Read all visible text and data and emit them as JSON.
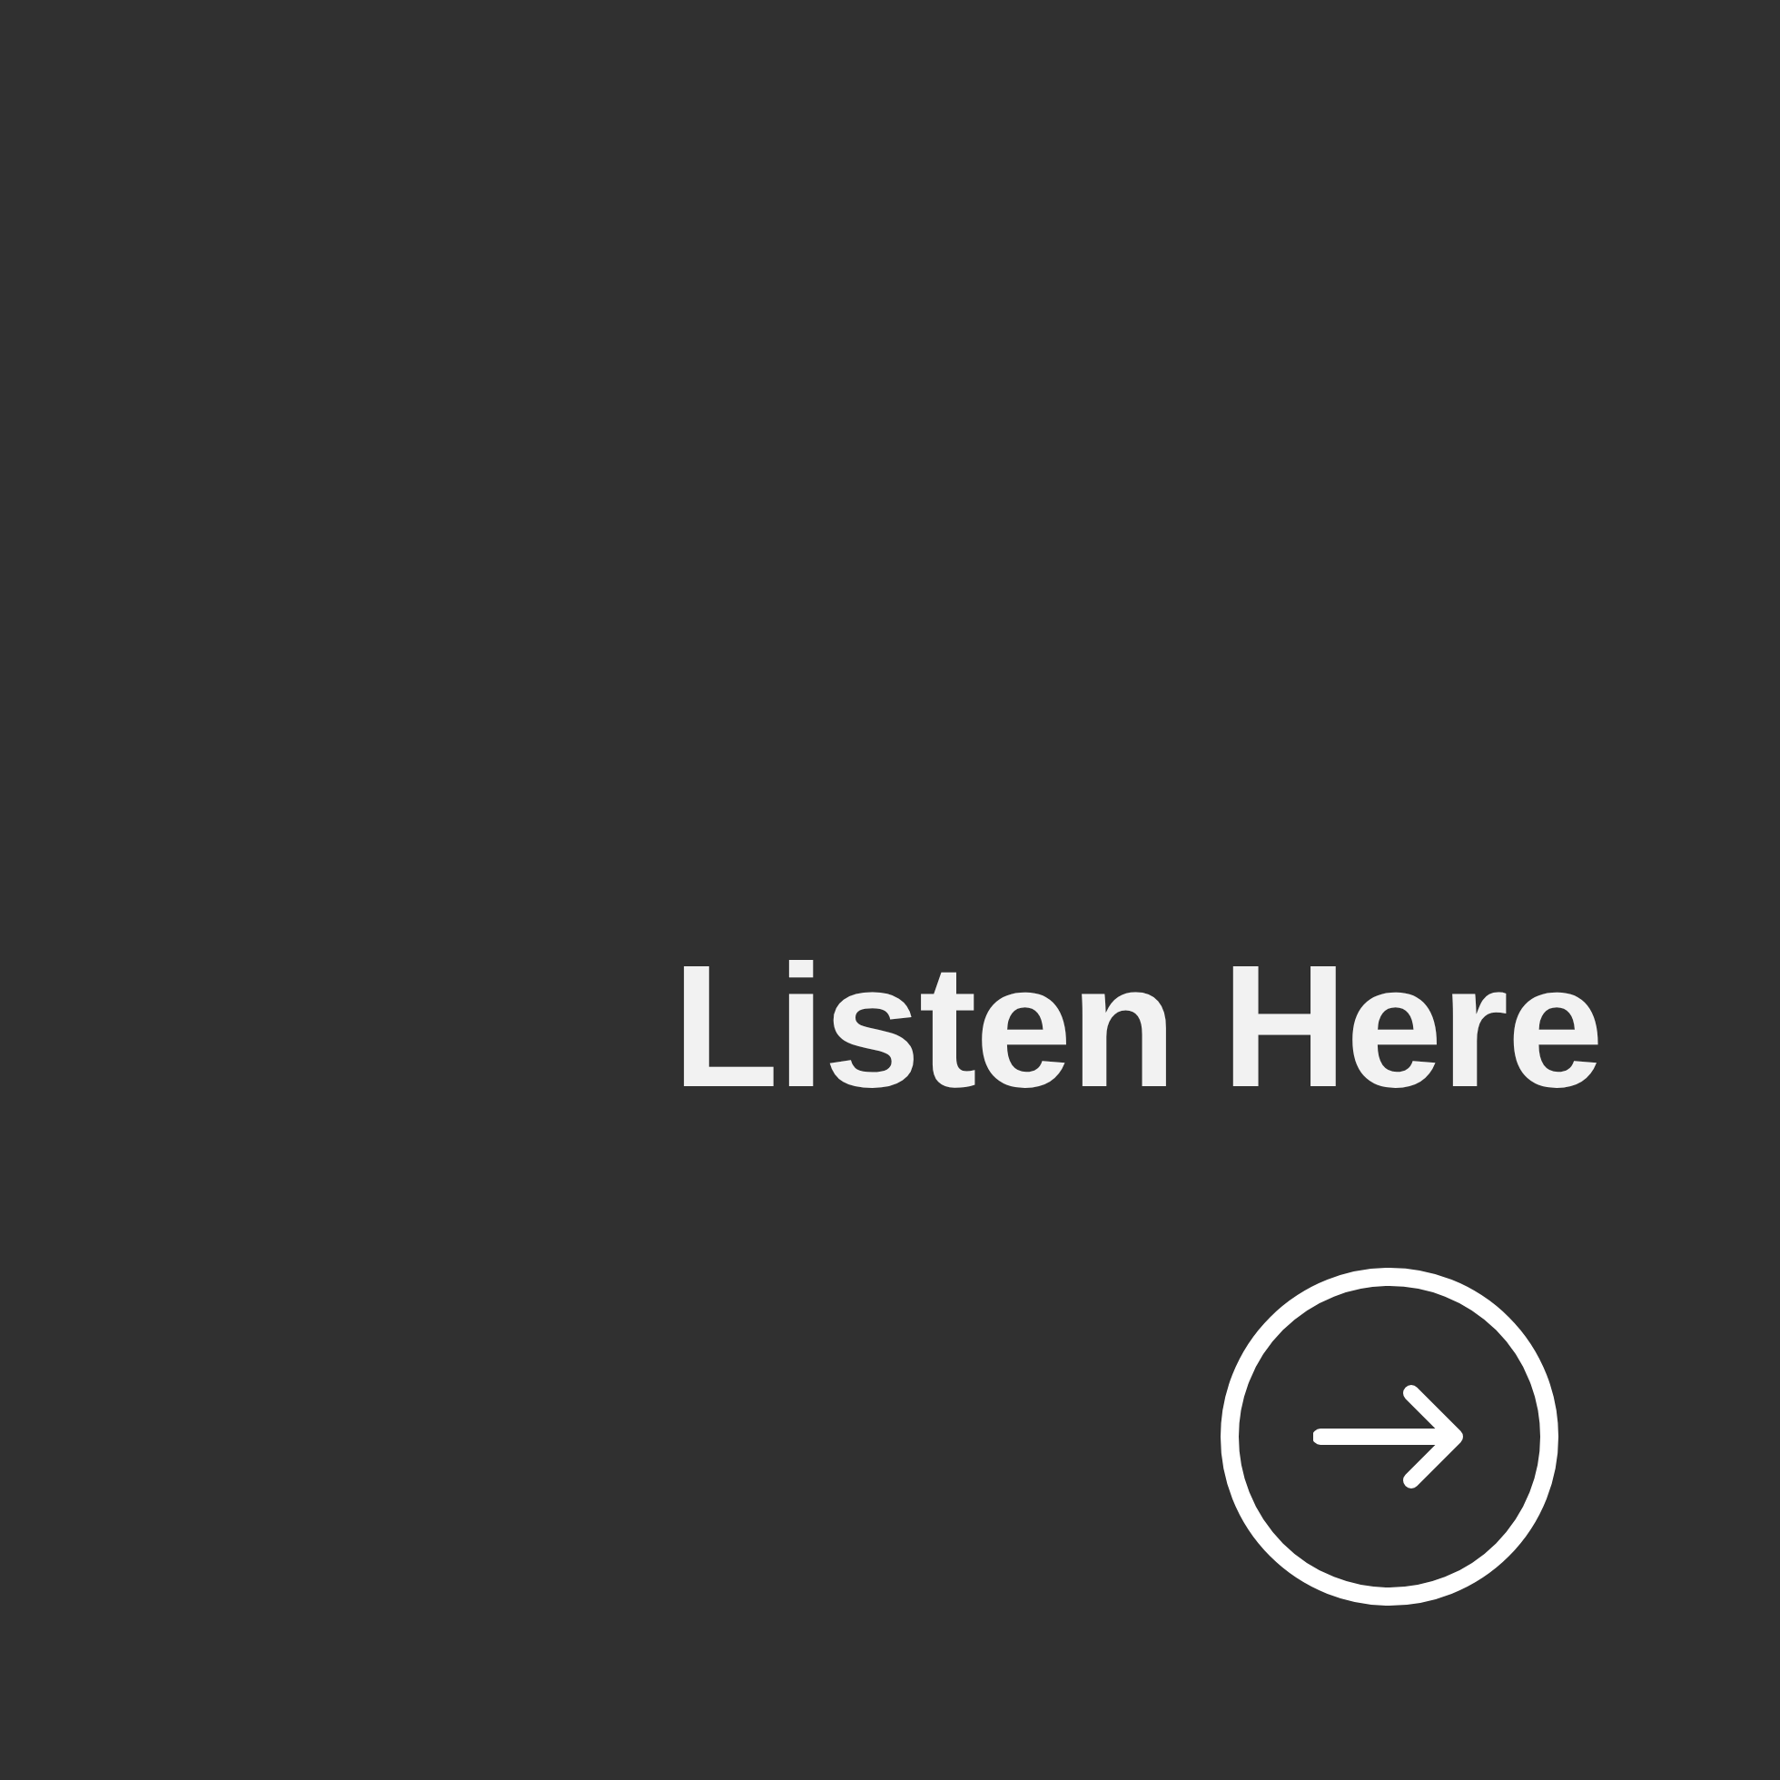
{
  "link": {
    "label": "Listen Here"
  }
}
